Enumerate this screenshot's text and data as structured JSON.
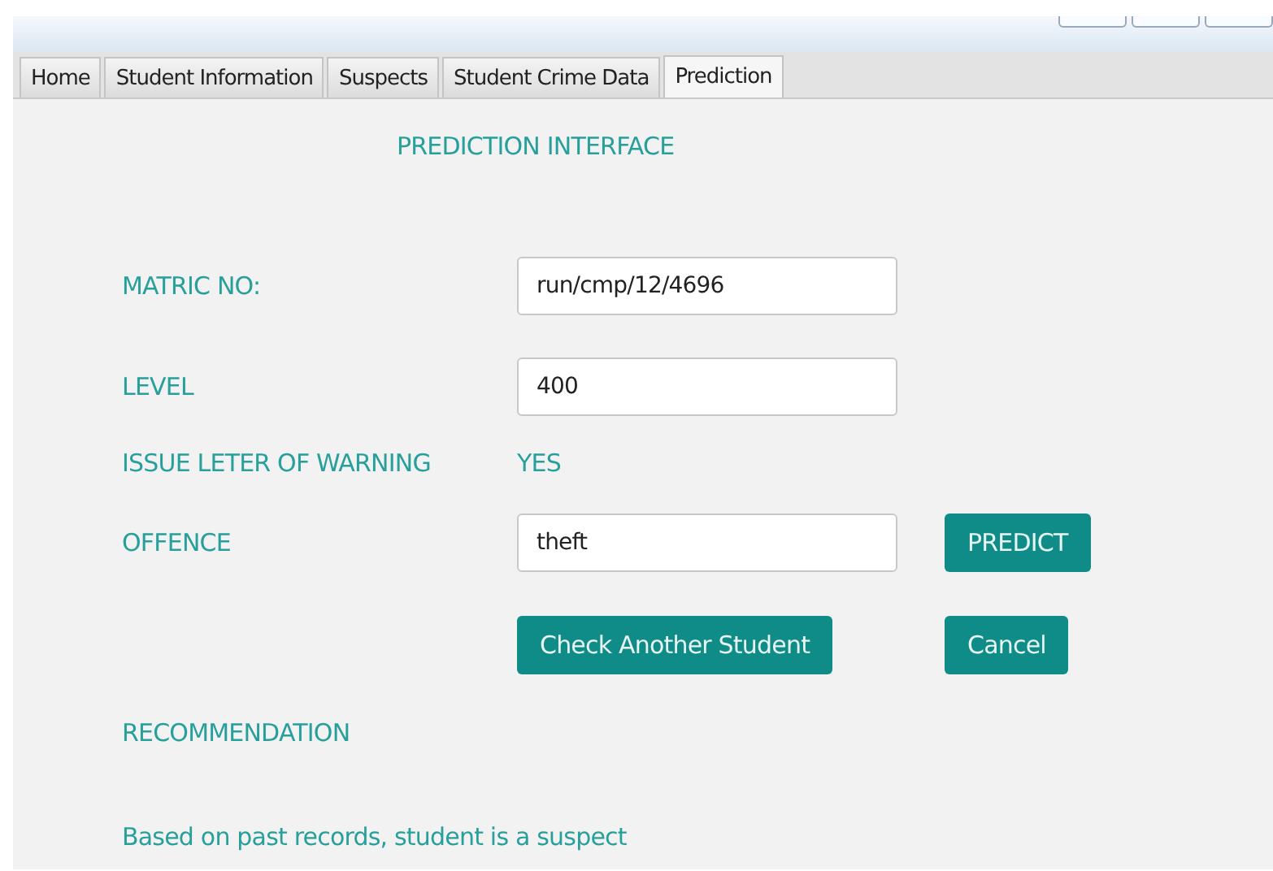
{
  "tabs": [
    {
      "label": "Home",
      "selected": false
    },
    {
      "label": "Student Information",
      "selected": false
    },
    {
      "label": "Suspects",
      "selected": false
    },
    {
      "label": "Student Crime Data",
      "selected": false
    },
    {
      "label": "Prediction",
      "selected": true
    }
  ],
  "heading": "PREDICTION INTERFACE",
  "rows": [
    {
      "kind": "field",
      "label": "MATRIC NO:",
      "value": "run/cmp/12/4696"
    },
    {
      "kind": "field",
      "label": "LEVEL",
      "value": "400"
    },
    {
      "kind": "text",
      "label": "ISSUE LETER OF WARNING",
      "value": "YES"
    },
    {
      "kind": "field",
      "label": "OFFENCE",
      "value": "theft",
      "button": "PREDICT"
    }
  ],
  "buttons": [
    "Check Another Student",
    "Cancel"
  ],
  "recommendation_label": "RECOMMENDATION",
  "recommendation": "Based on past records, student is a suspect"
}
